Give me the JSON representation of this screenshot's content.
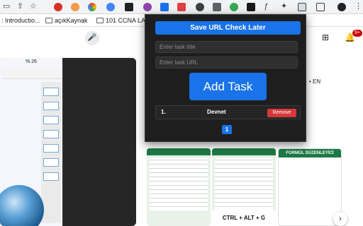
{
  "bookmarks": {
    "item1": ": Introductio...",
    "item2": "açıkKaynak",
    "item3": "101 CCNA LABS..."
  },
  "phone": {
    "status": "% 26"
  },
  "video": {
    "meta": "• EN"
  },
  "thumbnails": {
    "caption": "CTRL + ALT + G",
    "formula_header": "FORMÜL DÜZENLEYİCİ"
  },
  "notifications": {
    "badge": "9+"
  },
  "popup": {
    "save_button": "Save URL Check Later",
    "task_title_placeholder": "Enter task title",
    "task_url_placeholder": "Enter task URL",
    "add_button": "Add Task",
    "tasks": [
      {
        "index": "1.",
        "name": "Devnet",
        "remove_label": "Remove"
      }
    ],
    "current_page": "1"
  },
  "colors": {
    "accent": "#1a73e8",
    "danger": "#d7383b",
    "popup_bg": "#1e1e1e",
    "excel_green": "#1d7a45"
  },
  "icons": [
    "cast-icon",
    "bookmark-star-icon",
    "extension-icon",
    "puzzle-icon",
    "profile-icon",
    "mic-icon",
    "create-video-icon",
    "bell-icon",
    "chevron-right-icon"
  ]
}
